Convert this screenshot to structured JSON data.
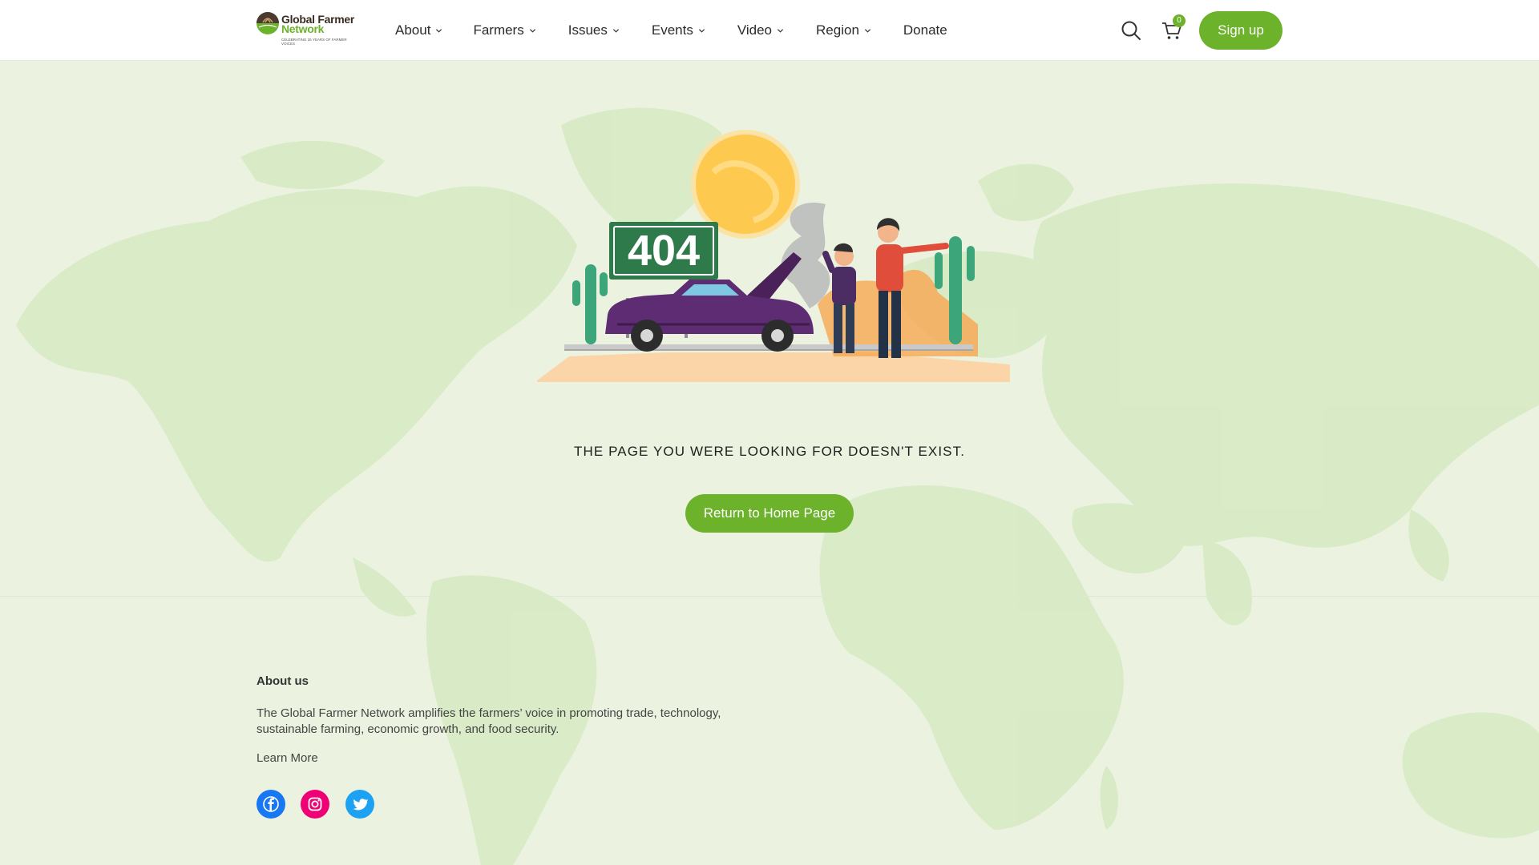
{
  "brand": {
    "name_line1": "Global Farmer",
    "name_line2": "Network",
    "tagline": "Celebrating 25 years of farmer voices",
    "accent_color": "#6cb22b"
  },
  "nav": {
    "items": [
      {
        "label": "About",
        "has_dropdown": true
      },
      {
        "label": "Farmers",
        "has_dropdown": true
      },
      {
        "label": "Issues",
        "has_dropdown": true
      },
      {
        "label": "Events",
        "has_dropdown": true
      },
      {
        "label": "Video",
        "has_dropdown": true
      },
      {
        "label": "Region",
        "has_dropdown": true
      },
      {
        "label": "Donate",
        "has_dropdown": false
      }
    ],
    "search_icon": "search-icon",
    "cart_icon": "cart-icon",
    "cart_count": "0",
    "signup_label": "Sign up"
  },
  "main": {
    "sign_text": "404",
    "message": "THE PAGE YOU WERE LOOKING FOR DOESN'T EXIST.",
    "home_button_label": "Return to Home Page"
  },
  "footer": {
    "title": "About us",
    "description": "The Global Farmer Network amplifies the farmers’ voice in promoting trade, technology, sustainable farming, economic growth, and food security.",
    "learn_more_label": "Learn More",
    "social": [
      {
        "name": "facebook-icon",
        "color": "#1877f2"
      },
      {
        "name": "instagram-icon",
        "color": "#f00075"
      },
      {
        "name": "twitter-icon",
        "color": "#1da1f2"
      }
    ]
  }
}
